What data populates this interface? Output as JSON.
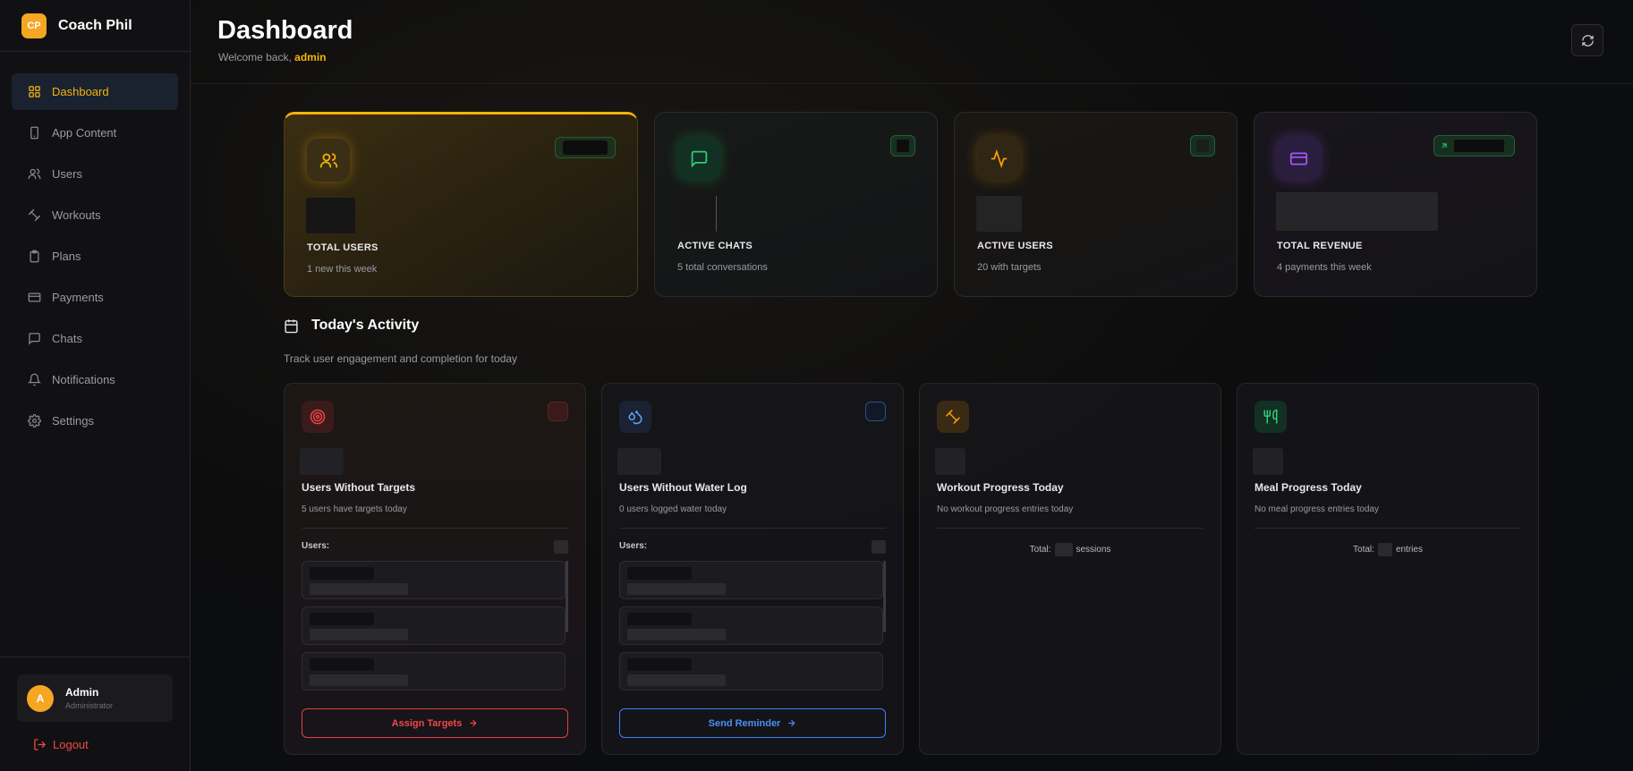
{
  "brand": {
    "logo_text": "CP",
    "name": "Coach Phil"
  },
  "sidebar": {
    "items": [
      {
        "label": "Dashboard",
        "icon": "grid-icon",
        "active": true
      },
      {
        "label": "App Content",
        "icon": "phone-icon"
      },
      {
        "label": "Users",
        "icon": "users-icon"
      },
      {
        "label": "Workouts",
        "icon": "dumbbell-icon"
      },
      {
        "label": "Plans",
        "icon": "clipboard-icon"
      },
      {
        "label": "Payments",
        "icon": "credit-card-icon"
      },
      {
        "label": "Chats",
        "icon": "message-icon"
      },
      {
        "label": "Notifications",
        "icon": "bell-icon"
      },
      {
        "label": "Settings",
        "icon": "gear-icon"
      }
    ],
    "user": {
      "initial": "A",
      "name": "Admin",
      "role": "Administrator"
    },
    "logout_label": "Logout"
  },
  "header": {
    "title": "Dashboard",
    "welcome_prefix": "Welcome back, ",
    "welcome_user": "admin",
    "refresh_icon": "refresh-icon"
  },
  "stats": [
    {
      "label": "TOTAL USERS",
      "sub": "1 new this week",
      "accent": "#f5b20a",
      "icon": "users-icon"
    },
    {
      "label": "ACTIVE CHATS",
      "sub": "5 total conversations",
      "accent": "#22c55e",
      "icon": "message-icon"
    },
    {
      "label": "ACTIVE USERS",
      "sub": "20 with targets",
      "accent": "#f59e0b",
      "icon": "activity-icon"
    },
    {
      "label": "TOTAL REVENUE",
      "sub": "4 payments this week",
      "accent": "#a855f7",
      "icon": "credit-card-icon"
    }
  ],
  "activity": {
    "title": "Today's Activity",
    "subtitle": "Track user engagement and completion for today",
    "cards": [
      {
        "title": "Users Without Targets",
        "sub": "5 users have targets today",
        "users_label": "Users:",
        "button_label": "Assign Targets",
        "accent": "#ef4444",
        "icon": "target-icon"
      },
      {
        "title": "Users Without Water Log",
        "sub": "0 users logged water today",
        "users_label": "Users:",
        "button_label": "Send Reminder",
        "accent": "#3b82f6",
        "icon": "droplets-icon"
      },
      {
        "title": "Workout Progress Today",
        "sub": "No workout progress entries today",
        "total_prefix": "Total:",
        "total_suffix": "sessions",
        "accent": "#f59e0b",
        "icon": "dumbbell-icon"
      },
      {
        "title": "Meal Progress Today",
        "sub": "No meal progress entries today",
        "total_prefix": "Total:",
        "total_suffix": "entries",
        "accent": "#22c55e",
        "icon": "utensils-icon"
      }
    ]
  }
}
